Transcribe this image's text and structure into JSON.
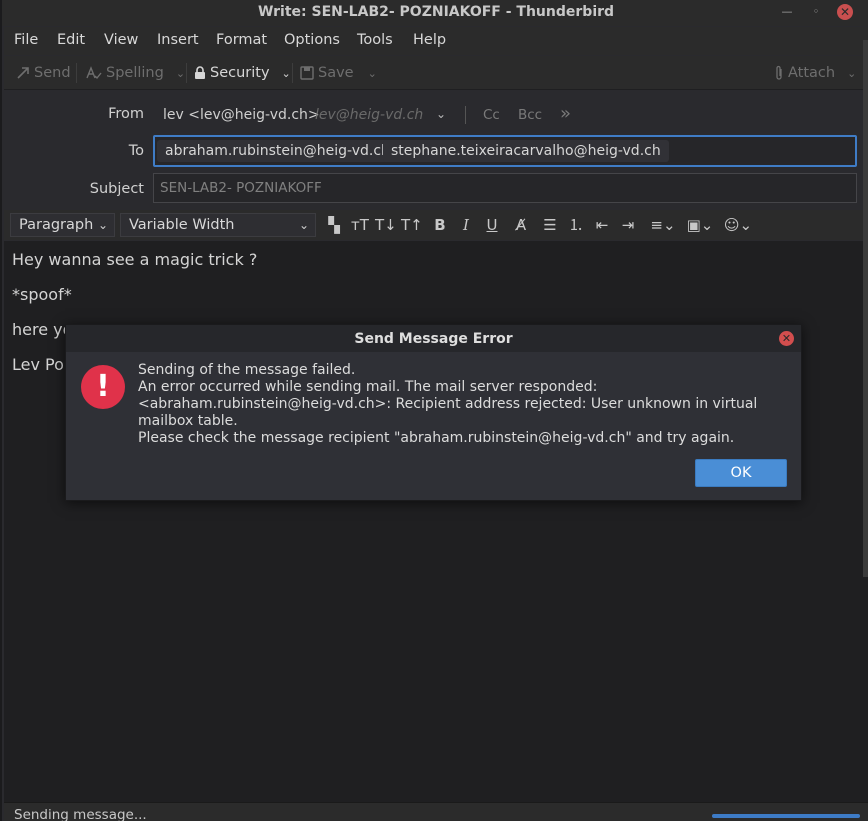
{
  "window": {
    "title": "Write: SEN-LAB2- POZNIAKOFF - Thunderbird"
  },
  "menubar": {
    "items": [
      {
        "label": "File"
      },
      {
        "label": "Edit"
      },
      {
        "label": "View"
      },
      {
        "label": "Insert"
      },
      {
        "label": "Format"
      },
      {
        "label": "Options"
      },
      {
        "label": "Tools"
      },
      {
        "label": "Help"
      }
    ]
  },
  "toolbar": {
    "send": "Send",
    "spelling": "Spelling",
    "security": "Security",
    "save": "Save",
    "attach": "Attach"
  },
  "headers": {
    "from_label": "From",
    "from_value": "lev <lev@heig-vd.ch>",
    "from_ghost": "lev@heig-vd.ch",
    "cc": "Cc",
    "bcc": "Bcc",
    "to_label": "To",
    "recipients": [
      "abraham.rubinstein@heig-vd.ch",
      "stephane.teixeiracarvalho@heig-vd.ch"
    ],
    "subject_label": "Subject",
    "subject_value": "SEN-LAB2- POZNIAKOFF"
  },
  "format": {
    "paragraph": "Paragraph",
    "font": "Variable Width"
  },
  "body": {
    "line1": "Hey wanna see a magic trick ?",
    "line2": "*spoof*",
    "line3": "here you",
    "line4": "Lev Po"
  },
  "dialog": {
    "title": "Send Message Error",
    "line1": "Sending of the message failed.",
    "line2": "An error occurred while sending mail. The mail server responded:",
    "line3": "<abraham.rubinstein@heig-vd.ch>: Recipient address rejected: User unknown in virtual mailbox table.",
    "line4": "Please check the message recipient \"abraham.rubinstein@heig-vd.ch\" and try again.",
    "ok": "OK"
  },
  "status": {
    "text": "Sending message...",
    "progress": 1.0
  },
  "colors": {
    "accent": "#3f7cc6",
    "error": "#e0324a",
    "close": "#d24e4e"
  }
}
